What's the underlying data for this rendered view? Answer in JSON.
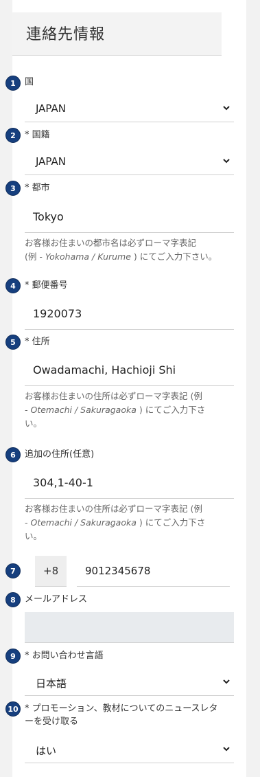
{
  "header": {
    "title": "連絡先情報"
  },
  "fields": {
    "country": {
      "number": "1",
      "label": "国",
      "value": "JAPAN"
    },
    "nationality": {
      "number": "2",
      "label": "* 国籍",
      "value": "JAPAN"
    },
    "city": {
      "number": "3",
      "label": "* 都市",
      "value": "Tokyo",
      "help_line1": "お客様お住まいの都市名は必ずローマ字表記",
      "help_line2_prefix": "(例 - ",
      "help_line2_italic": "Yokohama / Kurume",
      "help_line2_suffix": ") にてご入力下さい。"
    },
    "postal_code": {
      "number": "4",
      "label": "* 郵便番号",
      "value": "1920073"
    },
    "address": {
      "number": "5",
      "label": "* 住所",
      "value": "Owadamachi, Hachioji Shi",
      "help_line1_prefix": "お客様お住まいの住所は必ずローマ字表記 (例",
      "help_line2_italic": "- Otemachi / Sakuragaoka",
      "help_line2_suffix": ") にてご入力下さ",
      "help_line3": "い。"
    },
    "address2": {
      "number": "6",
      "label": "追加の住所(任意)",
      "value": "304,1-40-1",
      "help_line1_prefix": "お客様お住まいの住所は必ずローマ字表記 (例",
      "help_line2_italic": "- Otemachi / Sakuragaoka",
      "help_line2_suffix": ") にてご入力下さ",
      "help_line3": "い。"
    },
    "phone": {
      "number": "7",
      "country_code": "+8",
      "value": "9012345678"
    },
    "email": {
      "number": "8",
      "label": "メールアドレス",
      "value": ""
    },
    "language": {
      "number": "9",
      "label": "* お問い合わせ言語",
      "value": "日本語"
    },
    "newsletter": {
      "number": "10",
      "label_line1": "* プロモーション、教材についてのニュースレタ",
      "label_line2": "ーを受け取る",
      "value": "はい"
    }
  },
  "colors": {
    "badge": "#163f7e",
    "panel": "#ffffff",
    "background": "#f2f2f2"
  }
}
